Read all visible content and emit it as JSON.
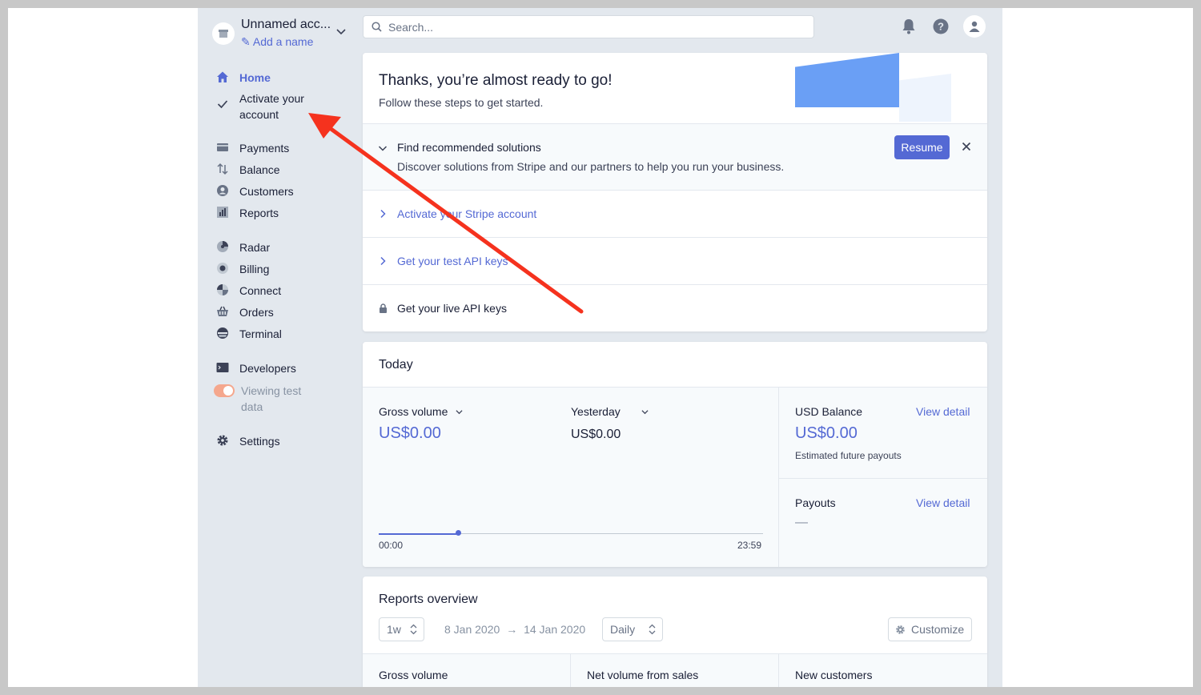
{
  "account": {
    "name": "Unnamed acc...",
    "add_name": "Add a name"
  },
  "sidebar": {
    "items": [
      {
        "label": "Home",
        "icon": "home-icon"
      },
      {
        "label": "Activate your",
        "label2": "account",
        "icon": "check-icon"
      },
      {
        "label": "Payments",
        "icon": "payments-icon"
      },
      {
        "label": "Balance",
        "icon": "balance-icon"
      },
      {
        "label": "Customers",
        "icon": "customers-icon"
      },
      {
        "label": "Reports",
        "icon": "reports-icon"
      },
      {
        "label": "Radar",
        "icon": "radar-icon"
      },
      {
        "label": "Billing",
        "icon": "billing-icon"
      },
      {
        "label": "Connect",
        "icon": "connect-icon"
      },
      {
        "label": "Orders",
        "icon": "orders-icon"
      },
      {
        "label": "Terminal",
        "icon": "terminal-icon"
      },
      {
        "label": "Developers",
        "icon": "developers-icon"
      },
      {
        "label": "Viewing test",
        "label2": "data",
        "icon": "toggle"
      },
      {
        "label": "Settings",
        "icon": "gear-icon"
      }
    ]
  },
  "search": {
    "placeholder": "Search..."
  },
  "setup": {
    "title": "Thanks, you’re almost ready to go!",
    "subtitle": "Follow these steps to get started.",
    "steps": [
      {
        "title": "Find recommended solutions",
        "desc": "Discover solutions from Stripe and our partners to help you run your business."
      },
      {
        "title": "Activate your Stripe account"
      },
      {
        "title": "Get your test API keys"
      },
      {
        "title": "Get your live API keys"
      }
    ],
    "resume_label": "Resume"
  },
  "today": {
    "title": "Today",
    "gross_label": "Gross volume",
    "gross_value": "US$0.00",
    "yesterday_label": "Yesterday",
    "yesterday_value": "US$0.00",
    "start_time": "00:00",
    "end_time": "23:59",
    "balance_label": "USD Balance",
    "balance_value": "US$0.00",
    "balance_sub": "Estimated future payouts",
    "payouts_label": "Payouts",
    "payouts_value": "—",
    "view_detail": "View detail"
  },
  "reports": {
    "title": "Reports overview",
    "range": "1w",
    "date_from": "8 Jan 2020",
    "date_to": "14 Jan 2020",
    "interval": "Daily",
    "customize": "Customize",
    "columns": [
      "Gross volume",
      "Net volume from sales",
      "New customers"
    ]
  },
  "colors": {
    "accent": "#5469d4",
    "annotation_arrow": "#f5321e"
  }
}
